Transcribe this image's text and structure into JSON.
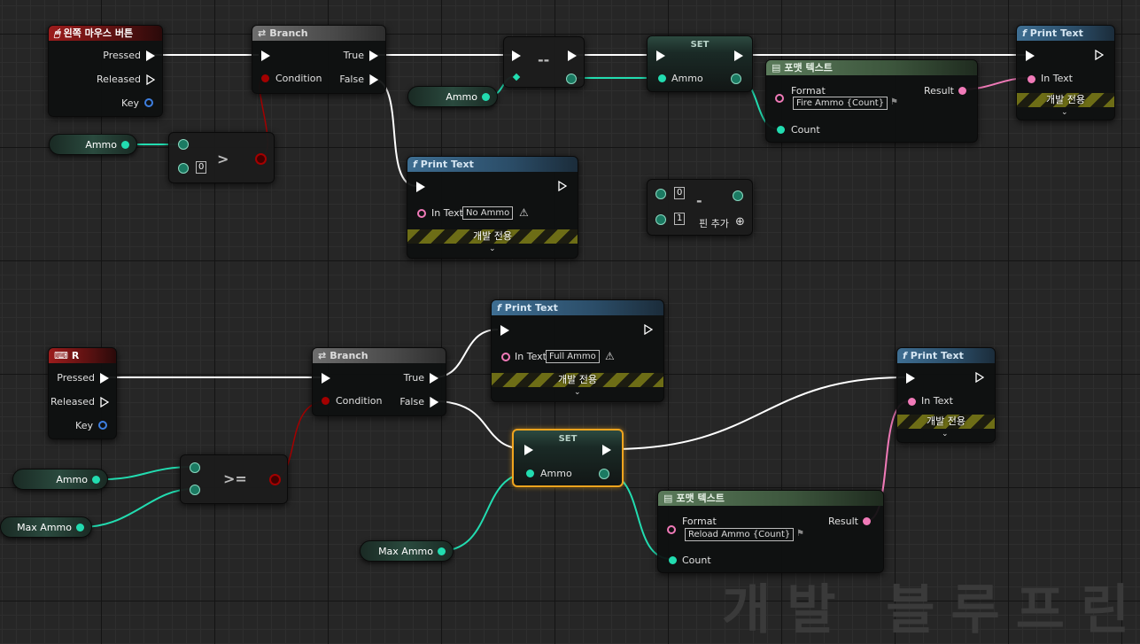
{
  "watermark": "개발 블루프린",
  "event_lmb": {
    "title": "왼쪽 마우스 버튼",
    "pressed": "Pressed",
    "released": "Released",
    "key": "Key"
  },
  "event_r": {
    "title": "R",
    "pressed": "Pressed",
    "released": "Released",
    "key": "Key"
  },
  "branch1": {
    "title": "Branch",
    "true": "True",
    "false": "False",
    "condition": "Condition"
  },
  "branch2": {
    "title": "Branch",
    "true": "True",
    "false": "False",
    "condition": "Condition"
  },
  "ammo_get1": "Ammo",
  "ammo_get2": "Ammo",
  "ammo_get3": "Ammo",
  "maxammo_get1": "Max Ammo",
  "maxammo_get2": "Max Ammo",
  "compare_gt": {
    "op": ">",
    "value": "0"
  },
  "compare_ge": {
    "op": ">="
  },
  "decrement": {
    "op": "--"
  },
  "subtract": {
    "op": "-",
    "a": "0",
    "b": "1",
    "add_pin": "핀 추가"
  },
  "set1": {
    "title": "SET",
    "var": "Ammo"
  },
  "set2": {
    "title": "SET",
    "var": "Ammo"
  },
  "format1": {
    "title": "포맷 텍스트",
    "format_label": "Format",
    "format_value": "Fire Ammo {Count}",
    "result": "Result",
    "count": "Count"
  },
  "format2": {
    "title": "포맷 텍스트",
    "format_label": "Format",
    "format_value": "Reload Ammo {Count}",
    "result": "Result",
    "count": "Count"
  },
  "print1": {
    "title": "Print Text",
    "in_text": "In Text",
    "dev_only": "개발 전용"
  },
  "print2": {
    "title": "Print Text",
    "in_text": "In Text",
    "value": "No Ammo",
    "dev_only": "개발 전용"
  },
  "print3": {
    "title": "Print Text",
    "in_text": "In Text",
    "value": "Full Ammo",
    "dev_only": "개발 전용"
  },
  "print4": {
    "title": "Print Text",
    "in_text": "In Text",
    "dev_only": "개발 전용"
  },
  "colors": {
    "exec": "#ffffff",
    "integer": "#22dcb0",
    "text": "#f07ab8",
    "bool": "#a30000",
    "struct": "#3e7fe0",
    "selection": "#f0a41e"
  }
}
